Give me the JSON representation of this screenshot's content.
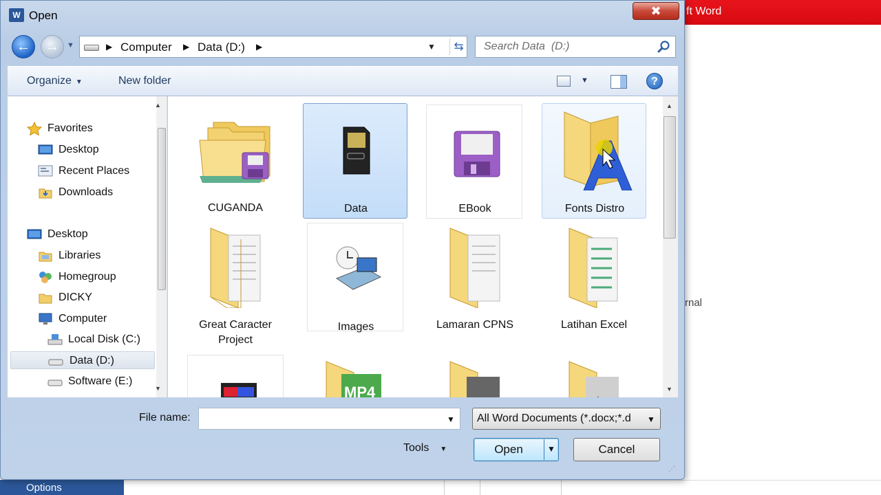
{
  "background_app": {
    "title_fragment": "ft Word",
    "side_text": "rnal",
    "options_label": "Options"
  },
  "dialog": {
    "title": "Open",
    "close_glyph": "✖",
    "nav": {
      "back_glyph": "←",
      "forward_glyph": "→",
      "history_glyph": "▼"
    },
    "address": {
      "segments": [
        "Computer",
        "Data  (D:)"
      ],
      "separator": "▶",
      "dropdown_glyph": "▼",
      "refresh_glyph": "⇆"
    },
    "search": {
      "placeholder": "Search Data  (D:)"
    },
    "toolbar": {
      "organize": "Organize",
      "new_folder": "New folder",
      "dropdown_glyph": "▼",
      "help_glyph": "?"
    },
    "navpane": {
      "items": [
        {
          "label": "Favorites",
          "icon": "star-icon"
        },
        {
          "label": "Desktop",
          "icon": "desktop-icon"
        },
        {
          "label": "Recent Places",
          "icon": "recent-places-icon"
        },
        {
          "label": "Downloads",
          "icon": "downloads-folder-icon"
        },
        {
          "label": "Desktop",
          "icon": "desktop-icon"
        },
        {
          "label": "Libraries",
          "icon": "libraries-icon"
        },
        {
          "label": "Homegroup",
          "icon": "homegroup-icon"
        },
        {
          "label": "DICKY",
          "icon": "user-folder-icon"
        },
        {
          "label": "Computer",
          "icon": "computer-icon"
        },
        {
          "label": "Local Disk (C:)",
          "icon": "local-disk-icon"
        },
        {
          "label": "Data  (D:)",
          "icon": "drive-icon"
        },
        {
          "label": "Software (E:)",
          "icon": "drive-icon"
        }
      ],
      "up_glyph": "▲",
      "down_glyph": "▼"
    },
    "files": [
      {
        "label": "CUGANDA",
        "icon": "folder-stack-icon"
      },
      {
        "label": "Data",
        "icon": "memory-card-icon"
      },
      {
        "label": "EBook",
        "icon": "floppy-disk-icon"
      },
      {
        "label": "Fonts Distro",
        "icon": "fonts-folder-icon"
      },
      {
        "label": "Great Caracter",
        "label2": "Project",
        "icon": "document-folder-icon"
      },
      {
        "label": "Images",
        "icon": "images-icon"
      },
      {
        "label": "Lamaran CPNS",
        "icon": "document-folder-icon"
      },
      {
        "label": "Latihan Excel",
        "icon": "excel-folder-icon"
      },
      {
        "label": "",
        "icon": "video-thumbnail-icon"
      },
      {
        "label": "",
        "icon": "mp4-folder-icon"
      },
      {
        "label": "",
        "icon": "photo-folder-icon"
      },
      {
        "label": "",
        "icon": "photo-folder-icon"
      }
    ],
    "filename": {
      "label": "File name:",
      "value": "",
      "dropdown_glyph": "▼"
    },
    "filetype": {
      "value": "All Word Documents (*.docx;*.d",
      "dropdown_glyph": "▼"
    },
    "tools": {
      "label": "Tools",
      "dropdown_glyph": "▼"
    },
    "buttons": {
      "open": "Open",
      "open_drop": "▼",
      "cancel": "Cancel"
    },
    "colors": {
      "accent": "#2b579a",
      "title_bar_red": "#e8141c",
      "selection": "#c4ddf8",
      "folder": "#f5d77c"
    }
  }
}
